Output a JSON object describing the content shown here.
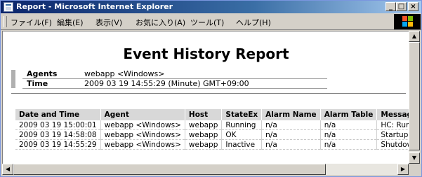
{
  "window": {
    "title": "Report - Microsoft Internet Explorer",
    "minimize": "_",
    "maximize": "□",
    "close": "×"
  },
  "menu": {
    "items": [
      {
        "label": "ファイル(F)"
      },
      {
        "label": "編集(E)"
      },
      {
        "label": "表示(V)"
      },
      {
        "label": "お気に入り(A)"
      },
      {
        "label": "ツール(T)"
      },
      {
        "label": "ヘルプ(H)"
      }
    ]
  },
  "report": {
    "title": "Event History Report",
    "agents_label": "Agents",
    "agents_value": "webapp <Windows>",
    "time_label": "Time",
    "time_value": "2009 03 19 14:55:29  (Minute)  GMT+09:00"
  },
  "table": {
    "columns": [
      "Date and Time",
      "Agent",
      "Host",
      "StateEx",
      "Alarm Name",
      "Alarm Table",
      "Message"
    ],
    "rows": [
      [
        "2009 03 19 15:00:01",
        "webapp <Windows>",
        "webapp",
        "Running",
        "n/a",
        "n/a",
        "HC: Runnin"
      ],
      [
        "2009 03 19 14:58:08",
        "webapp <Windows>",
        "webapp",
        "OK",
        "n/a",
        "n/a",
        "Startup"
      ],
      [
        "2009 03 19 14:55:29",
        "webapp <Windows>",
        "webapp",
        "Inactive",
        "n/a",
        "n/a",
        "Shutdown"
      ]
    ]
  },
  "scroll": {
    "up": "▲",
    "down": "▼",
    "left": "◀",
    "right": "▶"
  },
  "colors": {
    "titlebar_start": "#0a246a",
    "titlebar_end": "#a6caf0",
    "header_bg": "#d8d8d8",
    "chrome": "#d4d0c8"
  }
}
